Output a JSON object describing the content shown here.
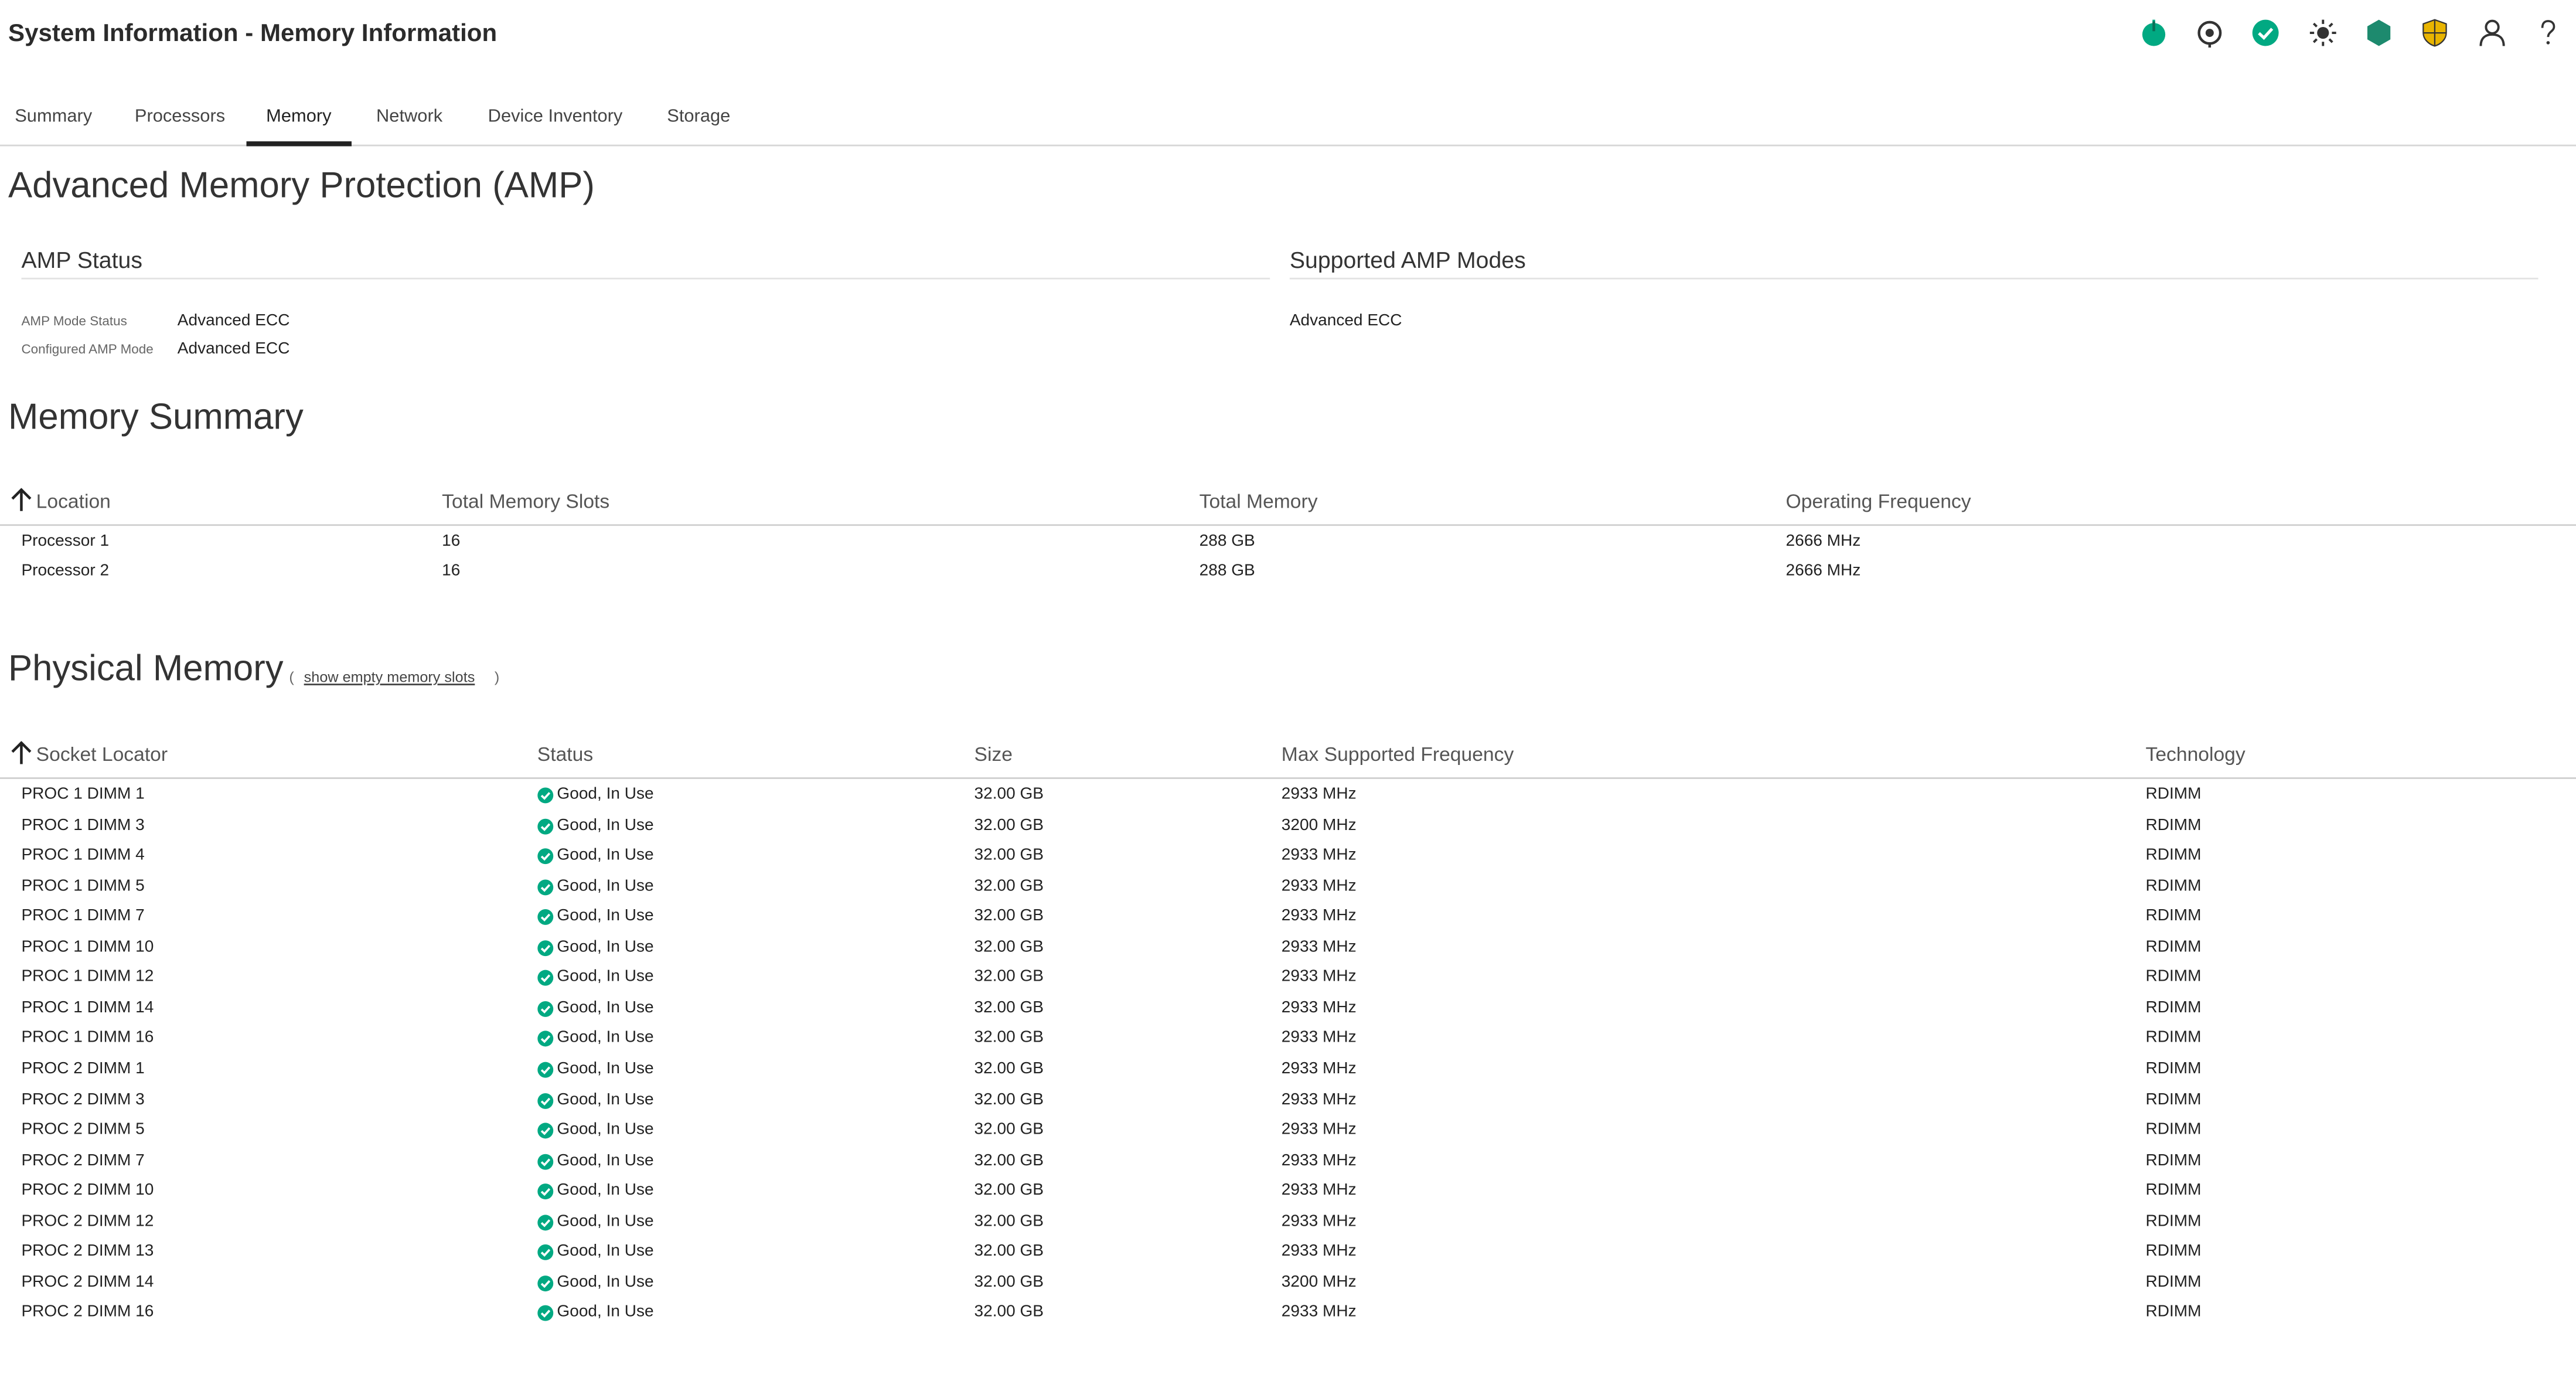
{
  "header": {
    "title": "System Information - Memory Information",
    "toolbar_icons": [
      "power-icon",
      "uid-target-icon",
      "health-ok-icon",
      "brightness-icon",
      "hexagon-icon",
      "security-shield-icon",
      "user-icon",
      "help-icon"
    ]
  },
  "tabs": [
    {
      "label": "Summary"
    },
    {
      "label": "Processors"
    },
    {
      "label": "Memory",
      "active": true
    },
    {
      "label": "Network"
    },
    {
      "label": "Device Inventory"
    },
    {
      "label": "Storage"
    }
  ],
  "amp": {
    "title": "Advanced Memory Protection (AMP)",
    "status_title": "AMP Status",
    "mode_status_label": "AMP Mode Status",
    "mode_status_value": "Advanced ECC",
    "configured_label": "Configured AMP Mode",
    "configured_value": "Advanced ECC",
    "supported_title": "Supported AMP Modes",
    "supported_modes": [
      "Advanced ECC"
    ]
  },
  "memory_summary": {
    "title": "Memory Summary",
    "columns": [
      "Location",
      "Total Memory Slots",
      "Total Memory",
      "Operating Frequency"
    ],
    "rows": [
      [
        "Processor 1",
        "16",
        "288 GB",
        "2666 MHz"
      ],
      [
        "Processor 2",
        "16",
        "288 GB",
        "2666 MHz"
      ]
    ]
  },
  "physical_memory": {
    "title": "Physical Memory",
    "paren_open": "(",
    "show_empty_link": "show empty memory slots",
    "paren_close": ")",
    "columns": [
      "Socket Locator",
      "Status",
      "Size",
      "Max Supported Frequency",
      "Technology"
    ],
    "rows": [
      [
        "PROC 1 DIMM 1",
        "Good, In Use",
        "32.00 GB",
        "2933 MHz",
        "RDIMM"
      ],
      [
        "PROC 1 DIMM 3",
        "Good, In Use",
        "32.00 GB",
        "3200 MHz",
        "RDIMM"
      ],
      [
        "PROC 1 DIMM 4",
        "Good, In Use",
        "32.00 GB",
        "2933 MHz",
        "RDIMM"
      ],
      [
        "PROC 1 DIMM 5",
        "Good, In Use",
        "32.00 GB",
        "2933 MHz",
        "RDIMM"
      ],
      [
        "PROC 1 DIMM 7",
        "Good, In Use",
        "32.00 GB",
        "2933 MHz",
        "RDIMM"
      ],
      [
        "PROC 1 DIMM 10",
        "Good, In Use",
        "32.00 GB",
        "2933 MHz",
        "RDIMM"
      ],
      [
        "PROC 1 DIMM 12",
        "Good, In Use",
        "32.00 GB",
        "2933 MHz",
        "RDIMM"
      ],
      [
        "PROC 1 DIMM 14",
        "Good, In Use",
        "32.00 GB",
        "2933 MHz",
        "RDIMM"
      ],
      [
        "PROC 1 DIMM 16",
        "Good, In Use",
        "32.00 GB",
        "2933 MHz",
        "RDIMM"
      ],
      [
        "PROC 2 DIMM 1",
        "Good, In Use",
        "32.00 GB",
        "2933 MHz",
        "RDIMM"
      ],
      [
        "PROC 2 DIMM 3",
        "Good, In Use",
        "32.00 GB",
        "2933 MHz",
        "RDIMM"
      ],
      [
        "PROC 2 DIMM 5",
        "Good, In Use",
        "32.00 GB",
        "2933 MHz",
        "RDIMM"
      ],
      [
        "PROC 2 DIMM 7",
        "Good, In Use",
        "32.00 GB",
        "2933 MHz",
        "RDIMM"
      ],
      [
        "PROC 2 DIMM 10",
        "Good, In Use",
        "32.00 GB",
        "2933 MHz",
        "RDIMM"
      ],
      [
        "PROC 2 DIMM 12",
        "Good, In Use",
        "32.00 GB",
        "2933 MHz",
        "RDIMM"
      ],
      [
        "PROC 2 DIMM 13",
        "Good, In Use",
        "32.00 GB",
        "2933 MHz",
        "RDIMM"
      ],
      [
        "PROC 2 DIMM 14",
        "Good, In Use",
        "32.00 GB",
        "3200 MHz",
        "RDIMM"
      ],
      [
        "PROC 2 DIMM 16",
        "Good, In Use",
        "32.00 GB",
        "2933 MHz",
        "RDIMM"
      ]
    ]
  },
  "colors": {
    "status_ok": "#01a982",
    "shield": "#e8b400",
    "hexagon": "#1d8a6e"
  }
}
